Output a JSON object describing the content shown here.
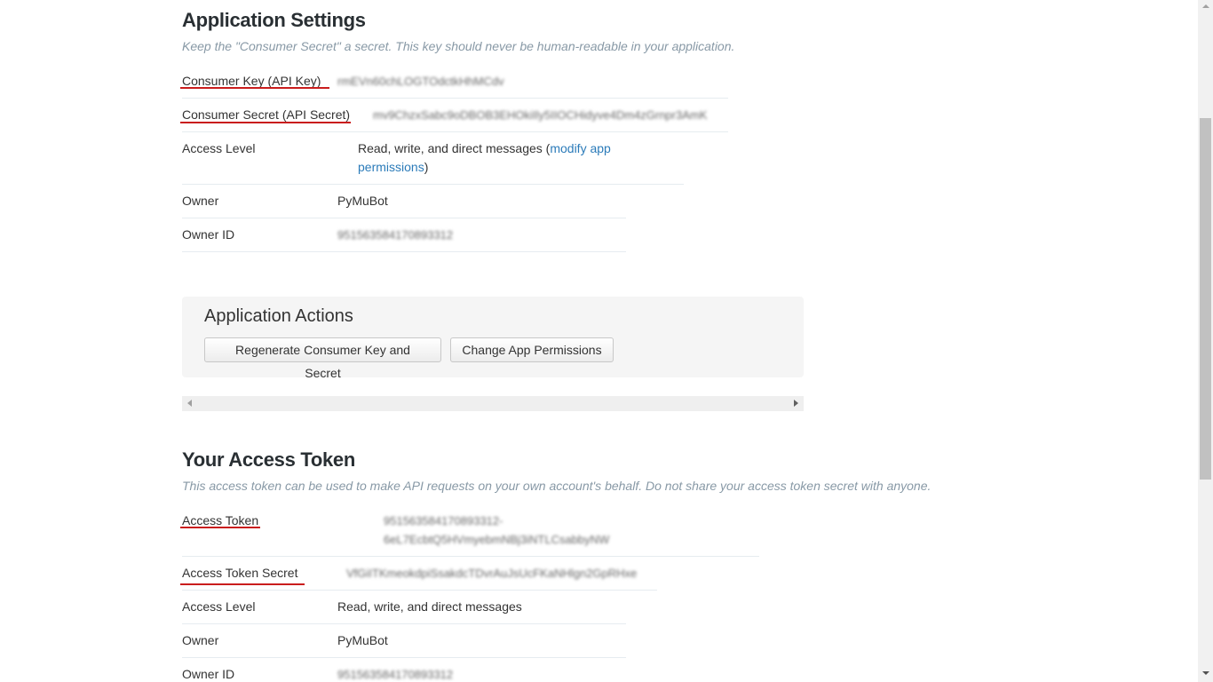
{
  "app_settings": {
    "title": "Application Settings",
    "description": "Keep the \"Consumer Secret\" a secret. This key should never be human-readable in your application.",
    "consumer_key_label": "Consumer Key (API Key)",
    "consumer_key_value": "rmEVn60chLOGTOdctkHhMCdv",
    "consumer_secret_label": "Consumer Secret (API Secret)",
    "consumer_secret_value": "mv9ChzxSabc9oDBOB3EHOkiIly5IIOCHidyve4Dm4zGrnpr3AmK",
    "access_level_label": "Access Level",
    "access_level_value": "Read, write, and direct messages (",
    "modify_link_line1": "modify app",
    "modify_link_line2": "permissions",
    "access_level_close": ")",
    "owner_label": "Owner",
    "owner_value": "PyMuBot",
    "owner_id_label": "Owner ID",
    "owner_id_value": "951563584170893312"
  },
  "actions": {
    "title": "Application Actions",
    "regenerate_label": "Regenerate Consumer Key and Secret",
    "change_permissions_label": "Change App Permissions"
  },
  "access_token": {
    "title": "Your Access Token",
    "description": "This access token can be used to make API requests on your own account's behalf. Do not share your access token secret with anyone.",
    "token_label": "Access Token",
    "token_value_line1": "951563584170893312-",
    "token_value_line2": "6eL7EcbtQ5HVmyebmNBj3iNTLCsabbyNW",
    "secret_label": "Access Token Secret",
    "secret_value": "VfGiITKmeokdpiSsakdcTDvrAuJsUcFKaNHlgn2GpRHxe",
    "access_level_label": "Access Level",
    "access_level_value": "Read, write, and direct messages",
    "owner_label": "Owner",
    "owner_value": "PyMuBot",
    "owner_id_label": "Owner ID",
    "owner_id_value": "951563584170893312"
  },
  "colors": {
    "link": "#2b7bb9",
    "annotation_underline": "#c91d1d",
    "panel_bg": "#f5f5f5"
  }
}
